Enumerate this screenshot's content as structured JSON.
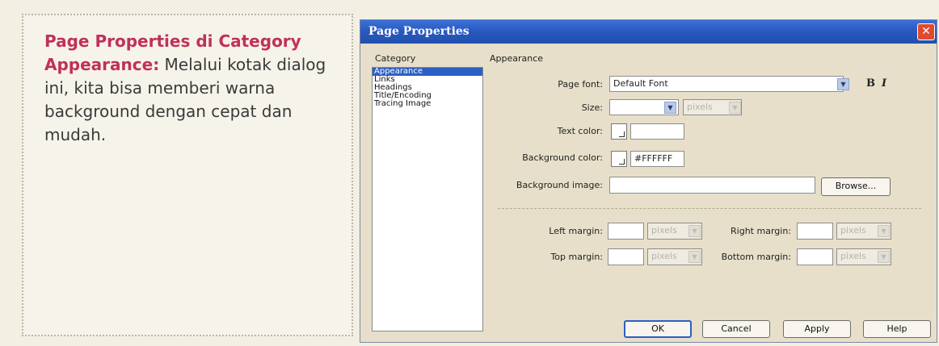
{
  "caption": {
    "title": "Page Properties di Category Appearance:",
    "body": "Melalui kotak dialog ini, kita bisa memberi warna background dengan cepat dan mudah."
  },
  "dialog": {
    "title": "Page Properties",
    "close_glyph": "✕",
    "category_label": "Category",
    "categories": [
      "Appearance",
      "Links",
      "Headings",
      "Title/Encoding",
      "Tracing Image"
    ],
    "selected_category": "Appearance",
    "section_heading": "Appearance",
    "page_font": {
      "label": "Page font:",
      "value": "Default Font",
      "bold": "B",
      "italic": "I"
    },
    "size": {
      "label": "Size:",
      "value": "",
      "unit": "pixels"
    },
    "text_color": {
      "label": "Text color:",
      "value": ""
    },
    "background_color": {
      "label": "Background color:",
      "value": "#FFFFFF"
    },
    "background_image": {
      "label": "Background image:",
      "value": "",
      "browse": "Browse..."
    },
    "left_margin": {
      "label": "Left margin:",
      "value": "",
      "unit": "pixels"
    },
    "right_margin": {
      "label": "Right margin:",
      "value": "",
      "unit": "pixels"
    },
    "top_margin": {
      "label": "Top margin:",
      "value": "",
      "unit": "pixels"
    },
    "bottom_margin": {
      "label": "Bottom margin:",
      "value": "",
      "unit": "pixels"
    },
    "buttons": {
      "ok": "OK",
      "cancel": "Cancel",
      "apply": "Apply",
      "help": "Help"
    }
  },
  "colors": {
    "accent_title": "#c0305a",
    "titlebar": "#2a59c0",
    "selection": "#2c5fc4"
  }
}
